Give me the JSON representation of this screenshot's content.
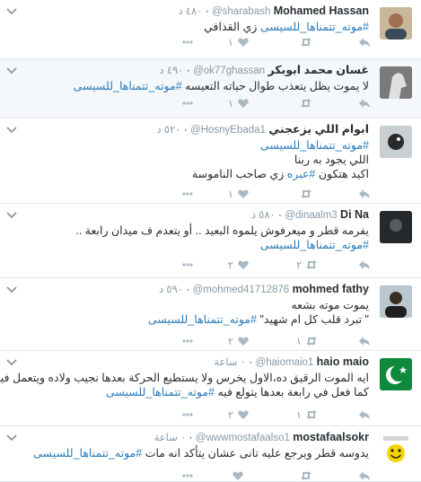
{
  "tweets": [
    {
      "name": "Mohamed Hassan",
      "handle": "@sharabash",
      "time": "٤٨٠ د",
      "lines": [
        [
          {
            "t": "#موته_تتمناها_للسيسى",
            "tag": true
          },
          {
            "t": " زي القذافي",
            "tag": false
          }
        ]
      ],
      "likes": "١",
      "retweets": "",
      "avatar_color": "#8a6a4a",
      "avatar": "person"
    },
    {
      "name": "غسان محمد ابوبكر",
      "handle": "@ok77ghassan",
      "time": "٤٩٠ د",
      "lines": [
        [
          {
            "t": "لا يموت يظل يتعذب طوال حياته التعيسه ",
            "tag": false
          },
          {
            "t": "#موته_تتمناها_للسيسى",
            "tag": true
          }
        ]
      ],
      "likes": "١",
      "retweets": "",
      "avatar_color": "#5a5a5a",
      "avatar": "horse"
    },
    {
      "name": "ابوام اللي يزعجني",
      "handle": "@HosnyEbada1",
      "time": "٥٢٠ د",
      "lines": [
        [
          {
            "t": "#موته_تتمناها_للسيسى",
            "tag": true
          }
        ],
        [
          {
            "t": "اللي يجود به ربنا",
            "tag": false
          }
        ],
        [
          {
            "t": "اكيد هتكون ",
            "tag": false
          },
          {
            "t": "#عبره",
            "tag": true
          },
          {
            "t": " زي صاحب الناموسة",
            "tag": false
          }
        ]
      ],
      "likes": "١",
      "retweets": "",
      "avatar_color": "#9aa6ad",
      "avatar": "bird"
    },
    {
      "name": "Di Na",
      "handle": "@dinaalm3",
      "time": "٥٨٠ د",
      "lines": [
        [
          {
            "t": "يفرمه قطر و ميعرفوش يلموه البعيد .. أو يتعدم ف ميدان رابعة ..",
            "tag": false
          }
        ],
        [
          {
            "t": "#موته_تتمناها_للسيسى",
            "tag": true
          }
        ]
      ],
      "likes": "٢",
      "retweets": "٢",
      "avatar_color": "#2f3338",
      "avatar": "dark"
    },
    {
      "name": "mohmed fathy",
      "handle": "@mohmed41712876",
      "time": "٥٩٠ د",
      "lines": [
        [
          {
            "t": "يموت موته بشعه",
            "tag": false
          }
        ],
        [
          {
            "t": "\" تبرد قلب كل ام شهيد\" ",
            "tag": false
          },
          {
            "t": "#موته_تتمناها_للسيسى",
            "tag": true
          }
        ]
      ],
      "likes": "٢",
      "retweets": "١",
      "avatar_color": "#3d2e24",
      "avatar": "person2"
    },
    {
      "name": "haio maio",
      "handle": "@haiomaio1",
      "time": "٠ ساعة",
      "lines": [
        [
          {
            "t": "ايه الموت الرقيق ده،الاول يخرس ولا يستطيع الحركة بعدها نجيب ولاده ويتعمل فيهم",
            "tag": false
          }
        ],
        [
          {
            "t": "كما فعل في رابعة بعدها يتولع فيه ",
            "tag": false
          },
          {
            "t": "#موته_تتمناها_للسيسى",
            "tag": true
          }
        ]
      ],
      "likes": "٢",
      "retweets": "١",
      "avatar_color": "#0f8a3c",
      "avatar": "crescent"
    },
    {
      "name": "mostafaalsokr",
      "handle": "@wwwmostafaalso1",
      "time": "٠ ساعة",
      "lines": [
        [
          {
            "t": "يدوسه قطر ويرجع عليه تانى عشان يتأكد انه مات ",
            "tag": false
          },
          {
            "t": "#موته_تتمناها_للسيسى",
            "tag": true
          }
        ]
      ],
      "likes": "",
      "retweets": "",
      "avatar_color": "#f5d400",
      "avatar": "smiley"
    }
  ],
  "icons": {
    "more": "more-dots-icon",
    "like": "heart-icon",
    "retweet": "retweet-icon",
    "reply": "reply-icon",
    "caret": "chevron-down-icon"
  },
  "colors": {
    "hashtag": "#2b7bb9",
    "name": "#292f33",
    "meta": "#8899a6",
    "highlight_bg": "#f5f8fa"
  }
}
